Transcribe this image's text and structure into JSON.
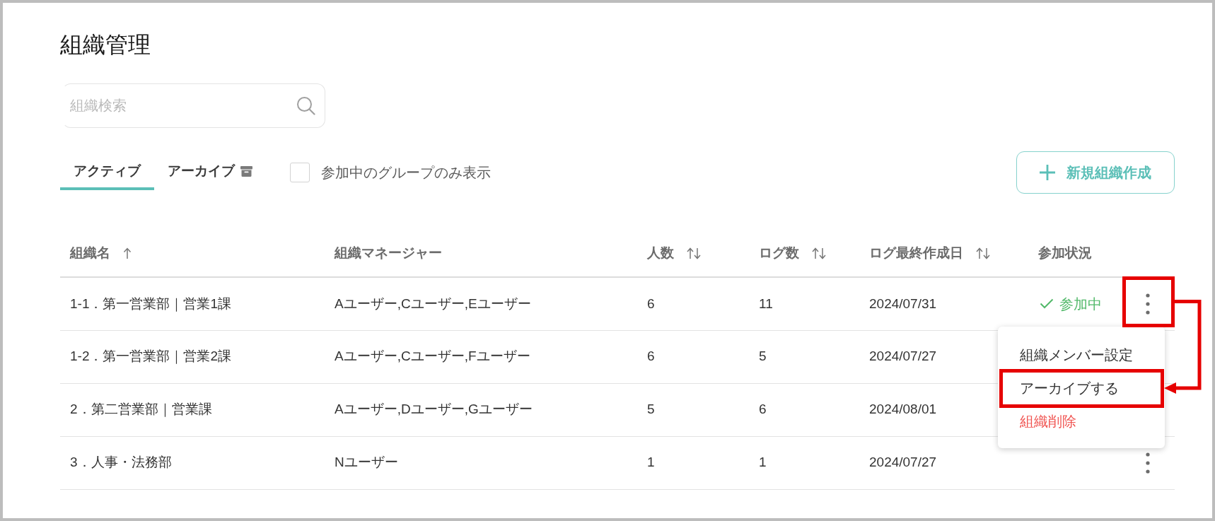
{
  "page": {
    "title": "組織管理"
  },
  "search": {
    "placeholder": "組織検索"
  },
  "tabs": [
    {
      "label": "アクティブ",
      "selected": true,
      "kind": "plain"
    },
    {
      "label": "アーカイブ",
      "selected": false,
      "kind": "archive"
    }
  ],
  "filter": {
    "label": "参加中のグループのみ表示",
    "checked": false
  },
  "new_button": {
    "label": "新規組織作成"
  },
  "table": {
    "columns": [
      {
        "label": "組織名",
        "sorted": true
      },
      {
        "label": "組織マネージャー"
      },
      {
        "label": "人数",
        "sortable": true
      },
      {
        "label": "ログ数",
        "sortable": true
      },
      {
        "label": "ログ最終作成日",
        "sortable": true
      },
      {
        "label": "参加状況"
      }
    ],
    "rows": [
      {
        "name": "1-1．第一営業部｜営業1課",
        "managers": "Aユーザー,Cユーザー,Eユーザー",
        "members": "6",
        "logs": "11",
        "last_log": "2024/07/31",
        "status": "参加中",
        "menu_button": {
          "annotated": true
        },
        "menu": {
          "items": [
            {
              "label": "組織メンバー設定",
              "kind": "normal",
              "annotated": false
            },
            {
              "label": "アーカイブする",
              "kind": "normal",
              "annotated": true
            },
            {
              "label": "組織削除",
              "kind": "danger",
              "annotated": false
            }
          ]
        }
      },
      {
        "name": "1-2．第一営業部｜営業2課",
        "managers": "Aユーザー,Cユーザー,Fユーザー",
        "members": "6",
        "logs": "5",
        "last_log": "2024/07/27"
      },
      {
        "name": "2．第二営業部｜営業課",
        "managers": "Aユーザー,Dユーザー,Gユーザー",
        "members": "5",
        "logs": "6",
        "last_log": "2024/08/01"
      },
      {
        "name": "3．人事・法務部",
        "managers": "Nユーザー",
        "members": "1",
        "logs": "1",
        "last_log": "2024/07/27",
        "menu_button": {
          "annotated": false
        }
      }
    ]
  },
  "annotation_arrow": true
}
